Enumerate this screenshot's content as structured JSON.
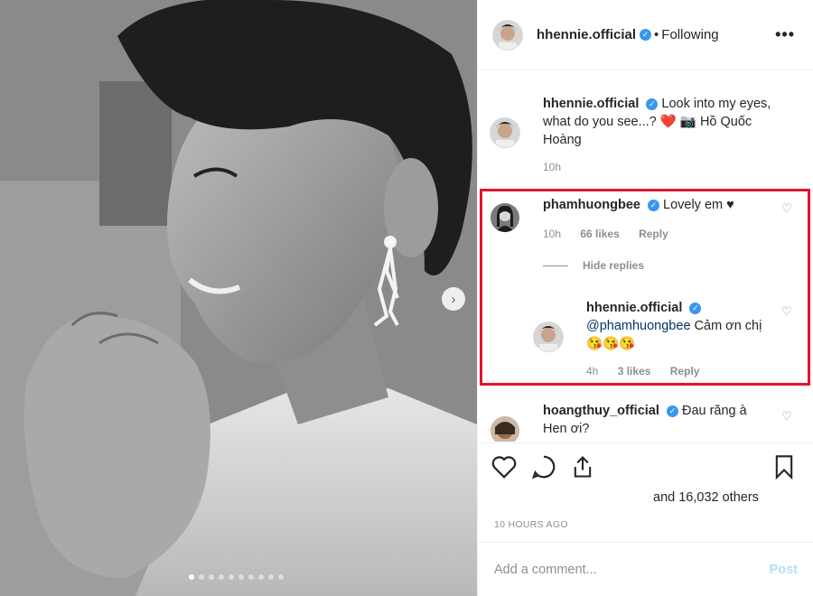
{
  "header": {
    "username": "hhennie.official",
    "verified_mark": "✓",
    "separator": "•",
    "following_label": "Following",
    "more_label": "•••"
  },
  "photo": {
    "next_icon": "chevron-right-icon",
    "carousel": {
      "total": 10,
      "current": 1
    }
  },
  "comments": [
    {
      "username": "hhennie.official",
      "text": "Look into my eyes, what do you see...? ❤️ 📷 Hồ Quốc Hoàng",
      "time": "10h"
    },
    {
      "username": "phamhuongbee",
      "text": "Lovely em ♥",
      "time": "10h",
      "likes": "66 likes",
      "reply": "Reply"
    },
    {
      "username": "hoangthuy_official",
      "text": "Đau răng à Hen ơi?"
    }
  ],
  "hide_replies_label": "Hide replies",
  "reply": {
    "username": "hhennie.official",
    "mention": "@phamhuongbee",
    "text": " Cảm ơn chị 😘😘😘",
    "time": "4h",
    "likes": "3 likes",
    "reply": "Reply"
  },
  "actions": {
    "likes_text": "and 16,032 others",
    "timestamp": "10 HOURS AGO"
  },
  "add_comment": {
    "placeholder": "Add a comment...",
    "post_label": "Post"
  },
  "colors": {
    "verified": "#3897f0",
    "highlight": "#e0152c",
    "post_disabled": "#b2dffc"
  }
}
